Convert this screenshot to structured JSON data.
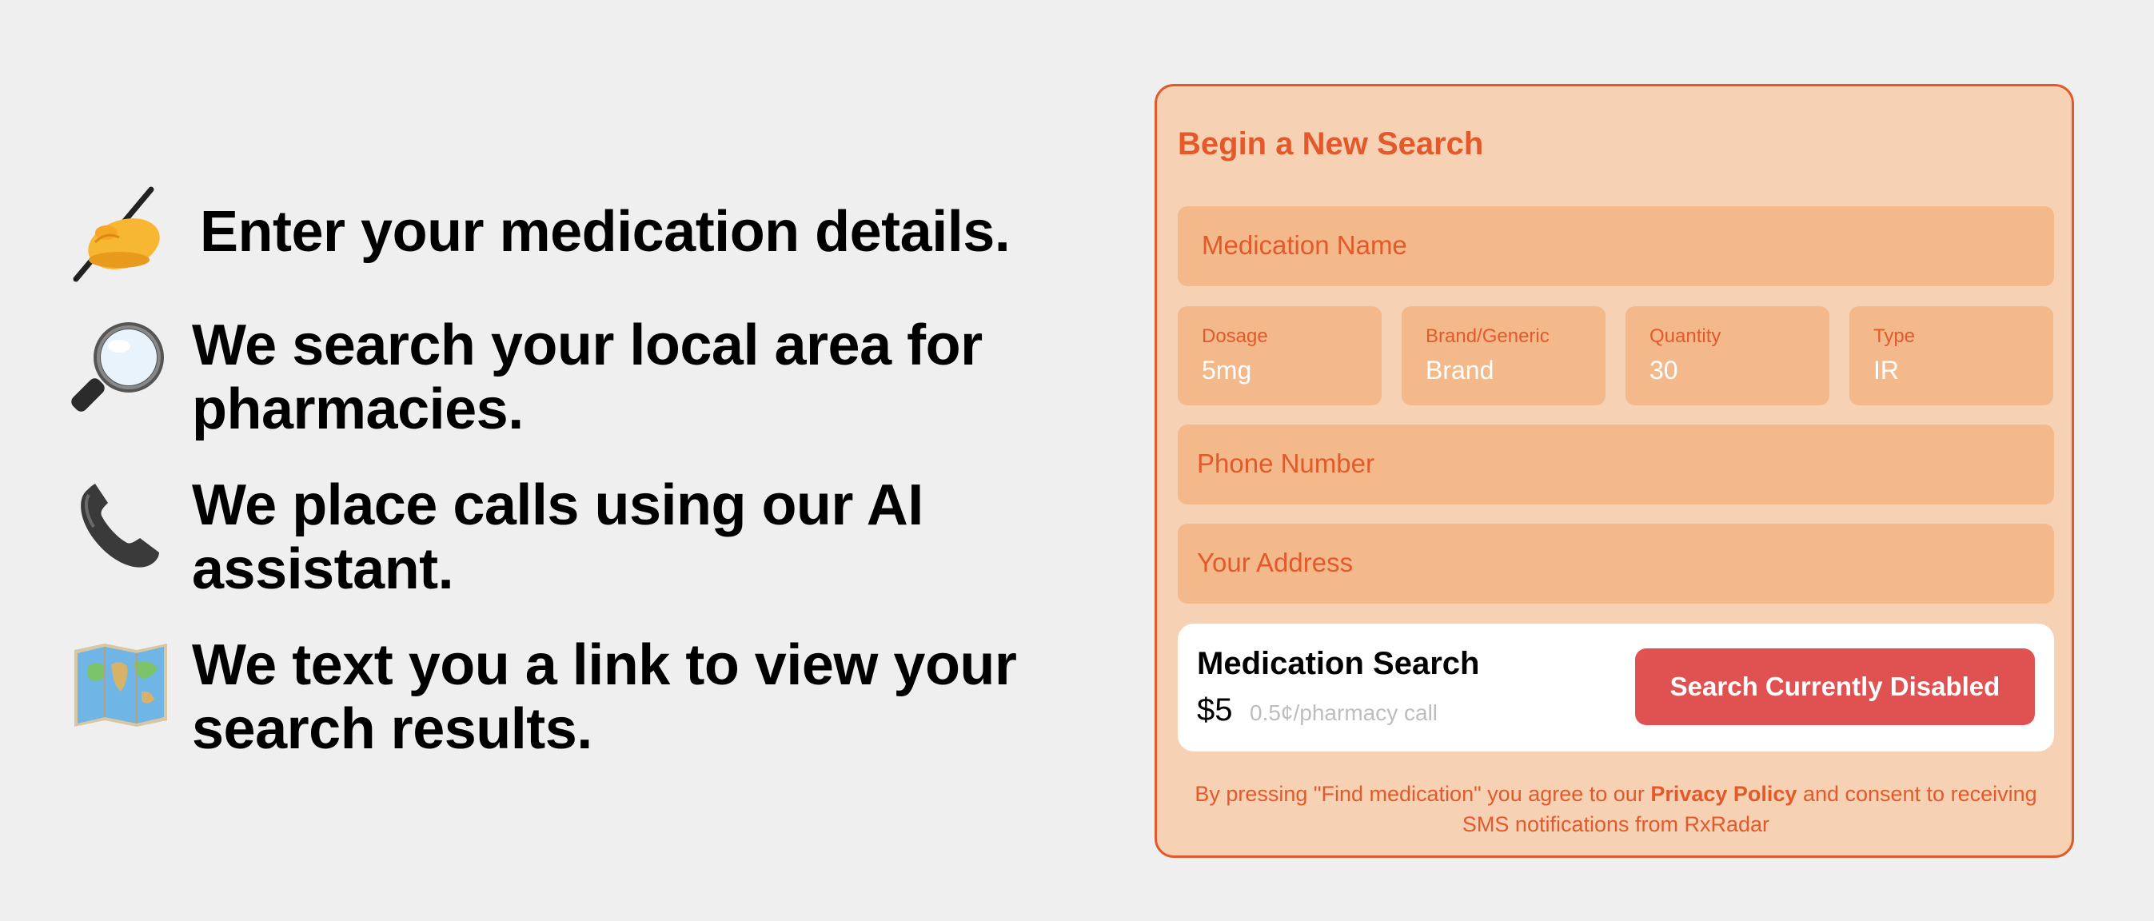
{
  "steps": [
    {
      "icon": "writing-hand-icon",
      "text": "Enter your medication details."
    },
    {
      "icon": "magnifying-glass-icon",
      "text_line1": "We search your local area for",
      "text_line2": "pharmacies."
    },
    {
      "icon": "telephone-icon",
      "text_line1": "We place calls using our AI",
      "text_line2": "assistant."
    },
    {
      "icon": "world-map-icon",
      "text_line1": "We text you a link to view your",
      "text_line2": "search results."
    }
  ],
  "form": {
    "title": "Begin a New Search",
    "medication_placeholder": "Medication Name",
    "dosage": {
      "label": "Dosage",
      "value": "5mg"
    },
    "brand": {
      "label": "Brand/Generic",
      "value": "Brand"
    },
    "quantity": {
      "label": "Quantity",
      "value": "30"
    },
    "type": {
      "label": "Type",
      "value": "IR"
    },
    "phone_placeholder": "Phone Number",
    "address_placeholder": "Your Address"
  },
  "payment": {
    "title": "Medication Search",
    "price": "$5",
    "rate": "0.5¢/pharmacy call",
    "button_label": "Search Currently Disabled"
  },
  "legal": {
    "prefix": "By pressing \"Find medication\" you agree to our ",
    "link": "Privacy Policy",
    "suffix": " and consent to receiving SMS notifications from RxRadar"
  },
  "colors": {
    "accent": "#e25a2b",
    "card_bg": "#f6d1b4",
    "field_bg": "#f4b98b",
    "button_bg": "#e05252",
    "page_bg": "#efefef"
  }
}
